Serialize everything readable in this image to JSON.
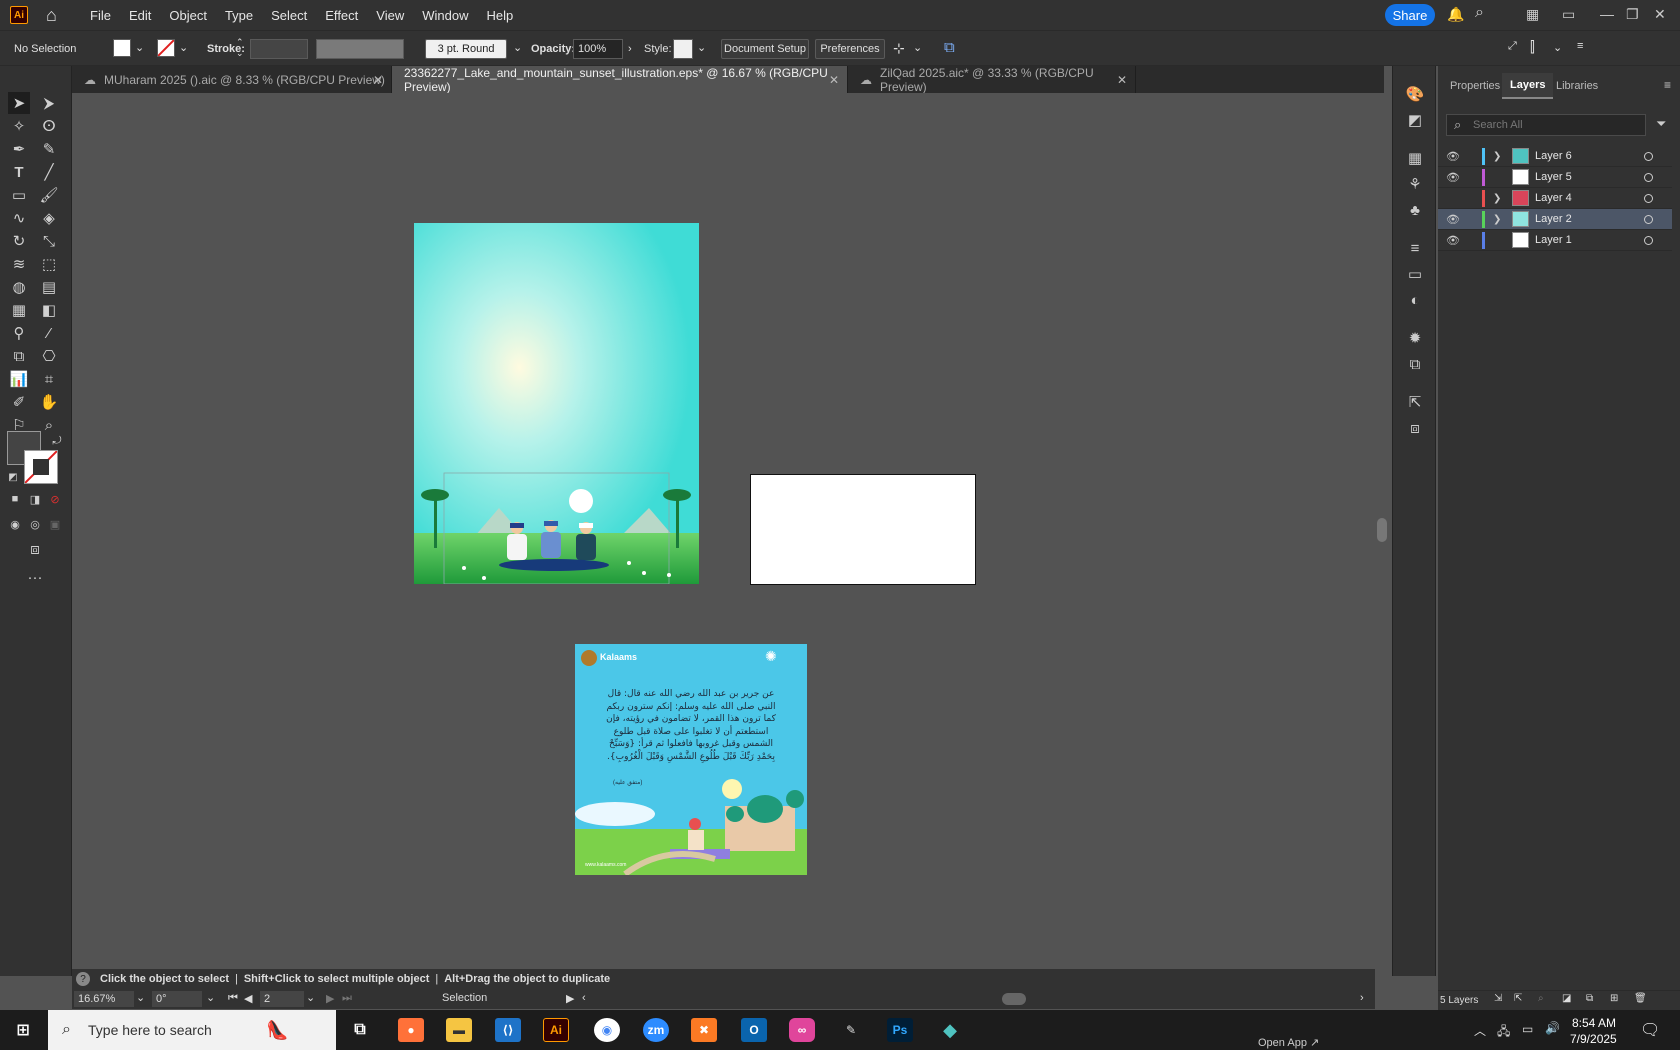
{
  "app": {
    "logo": "Ai",
    "menu": [
      "File",
      "Edit",
      "Object",
      "Type",
      "Select",
      "Effect",
      "View",
      "Window",
      "Help"
    ],
    "share": "Share"
  },
  "control": {
    "selection": "No Selection",
    "stroke_label": "Stroke:",
    "brush": "3 pt. Round",
    "opacity_label": "Opacity:",
    "opacity": "100%",
    "style_label": "Style:",
    "doc_setup": "Document Setup",
    "preferences": "Preferences"
  },
  "tabs": [
    {
      "label": "MUharam 2025 ().aic @ 8.33 % (RGB/CPU Preview)"
    },
    {
      "label": "23362277_Lake_and_mountain_sunset_illustration.eps* @ 16.67 % (RGB/CPU Preview)"
    },
    {
      "label": "ZilQad 2025.aic* @ 33.33 % (RGB/CPU Preview)"
    }
  ],
  "panel": {
    "tabs": [
      "Properties",
      "Layers",
      "Libraries"
    ],
    "search_placeholder": "Search All",
    "layers": [
      {
        "name": "Layer 6",
        "color": "#4fc3f7",
        "visible": true,
        "expandable": true,
        "selected": false
      },
      {
        "name": "Layer 5",
        "color": "#c05ad6",
        "visible": true,
        "expandable": false,
        "selected": false
      },
      {
        "name": "Layer 4",
        "color": "#e85050",
        "visible": false,
        "expandable": true,
        "selected": false
      },
      {
        "name": "Layer 2",
        "color": "#58d35a",
        "visible": true,
        "expandable": true,
        "selected": true
      },
      {
        "name": "Layer 1",
        "color": "#5a7fe8",
        "visible": true,
        "expandable": false,
        "selected": false
      }
    ],
    "layer_count": "5 Layers"
  },
  "artboard_card": {
    "brand": "Kalaams",
    "arabic_lines": [
      "عن جرير بن عبد الله رضي الله عنه قال: قال",
      "النبي صلى الله عليه وسلم: إنكم سترون ربكم",
      "كما ترون هذا القمر، لا تضامون في رؤيته، فإن",
      "استطعتم أن لا تغلبوا على صلاة قبل طلوع",
      "الشمس وقبل غروبها فافعلوا ثم قرأ: {وَسَبِّحْ",
      "بِحَمْدِ رَبِّكَ قَبْلَ طُلُوعِ الشَّمْسِ وَقَبْلَ الْغُرُوبِ}."
    ],
    "source": "(متفق عليه)",
    "url": "www.kalaams.com"
  },
  "hint": {
    "text1": "Click the object to select",
    "text2": "Shift+Click to select multiple object",
    "text3": "Alt+Drag the object to duplicate"
  },
  "status": {
    "zoom": "16.67%",
    "rotation": "0°",
    "artboard": "2",
    "tool": "Selection"
  },
  "taskbar": {
    "search": "Type here to search",
    "time": "8:54 AM",
    "date": "7/9/2025",
    "open_app": "Open App ↗"
  }
}
